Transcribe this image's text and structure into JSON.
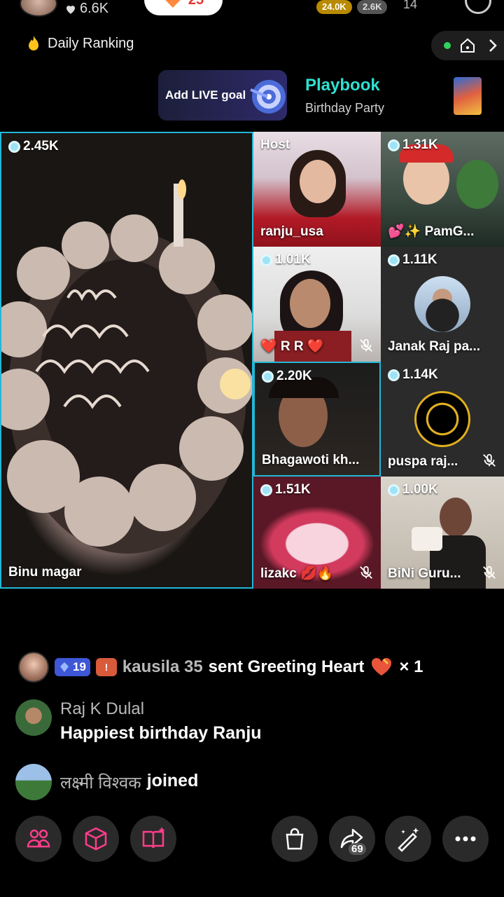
{
  "top": {
    "likes": "6.6K",
    "pill_count": "25",
    "coins_gold": "24.0K",
    "coins_grey": "2.6K",
    "viewers": "14"
  },
  "ranking": {
    "label": "Daily Ranking"
  },
  "goal": {
    "add_label": "Add LIVE goal"
  },
  "playbook": {
    "title": "Playbook",
    "subtitle": "Birthday Party"
  },
  "tiles": [
    {
      "name": "Binu magar",
      "count": "2.45K"
    },
    {
      "name": "ranju_usa",
      "host": "Host"
    },
    {
      "name": "💕✨ PamG...",
      "count": "1.31K"
    },
    {
      "name": "❤️ R R ❤️",
      "count": "1.01K"
    },
    {
      "name": "Janak Raj pa...",
      "count": "1.11K"
    },
    {
      "name": "Bhagawoti kh...",
      "count": "2.20K"
    },
    {
      "name": "puspa raj...",
      "count": "1.14K"
    },
    {
      "name": "lizakc 💋🔥",
      "count": "1.51K"
    },
    {
      "name": "BiNi Guru...",
      "count": "1.00K"
    }
  ],
  "comments": {
    "gift": {
      "level": "19",
      "user": "kausila 35",
      "action": "sent Greeting Heart",
      "multiplier": "× 1"
    },
    "message": {
      "user": "Raj K Dulal",
      "text": "Happiest birthday Ranju"
    },
    "join": {
      "user": "लक्ष्मी विश्वक",
      "action": "joined"
    }
  },
  "bottom": {
    "share_count": "69"
  },
  "colors": {
    "accent_cyan": "#22b8d6",
    "playbook_teal": "#2fe0d0",
    "icon_pink": "#ff3d8b"
  }
}
